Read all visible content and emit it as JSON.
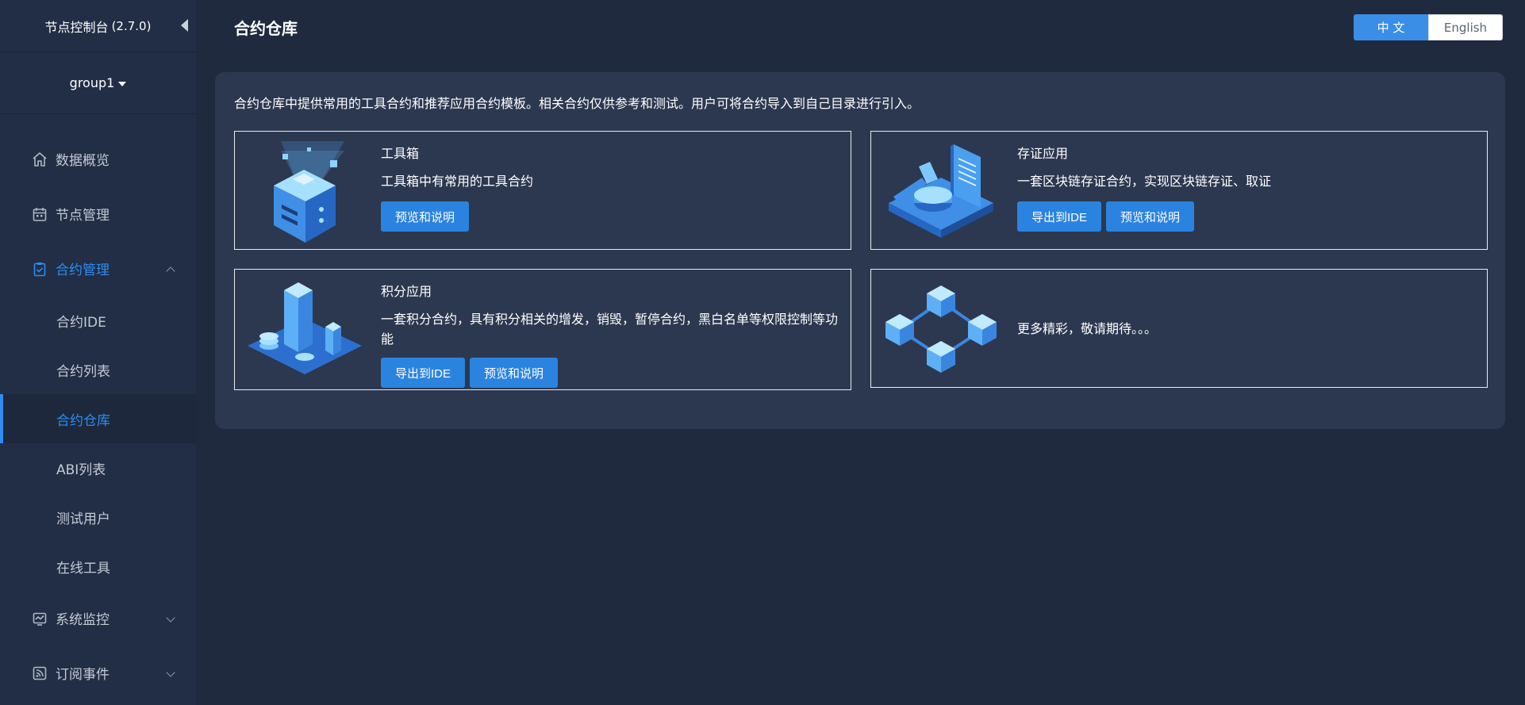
{
  "sidebar": {
    "brand_title": "节点控制台",
    "brand_version": "(2.7.0)",
    "group": "group1",
    "menu": [
      {
        "label": "数据概览",
        "icon": "home-icon"
      },
      {
        "label": "节点管理",
        "icon": "calendar-icon"
      },
      {
        "label": "合约管理",
        "icon": "clipboard-check-icon",
        "expanded": true
      },
      {
        "label": "系统监控",
        "icon": "monitor-chart-icon"
      },
      {
        "label": "订阅事件",
        "icon": "rss-icon"
      }
    ],
    "contract_submenu": [
      "合约IDE",
      "合约列表",
      "合约仓库",
      "ABI列表",
      "测试用户",
      "在线工具"
    ],
    "active_submenu": "合约仓库"
  },
  "header": {
    "title": "合约仓库",
    "lang_zh": "中 文",
    "lang_en": "English"
  },
  "main": {
    "intro": "合约仓库中提供常用的工具合约和推荐应用合约模板。相关合约仅供参考和测试。用户可将合约导入到自己目录进行引入。",
    "cards": [
      {
        "title": "工具箱",
        "desc": "工具箱中有常用的工具合约",
        "buttons": [
          "预览和说明"
        ]
      },
      {
        "title": "存证应用",
        "desc": "一套区块链存证合约，实现区块链存证、取证",
        "buttons": [
          "导出到IDE",
          "预览和说明"
        ]
      },
      {
        "title": "积分应用",
        "desc": "一套积分合约，具有积分相关的增发，销毁，暂停合约，黑白名单等权限控制等功能",
        "buttons": [
          "导出到IDE",
          "预览和说明"
        ]
      },
      {
        "title": "",
        "desc": "更多精彩，敬请期待。。。",
        "buttons": []
      }
    ]
  },
  "colors": {
    "accent": "#2f8cf0",
    "sidebar_bg": "#222e45",
    "page_bg": "#1f2a3e",
    "panel_bg": "#2c384f",
    "button_bg": "#2b83e0"
  }
}
